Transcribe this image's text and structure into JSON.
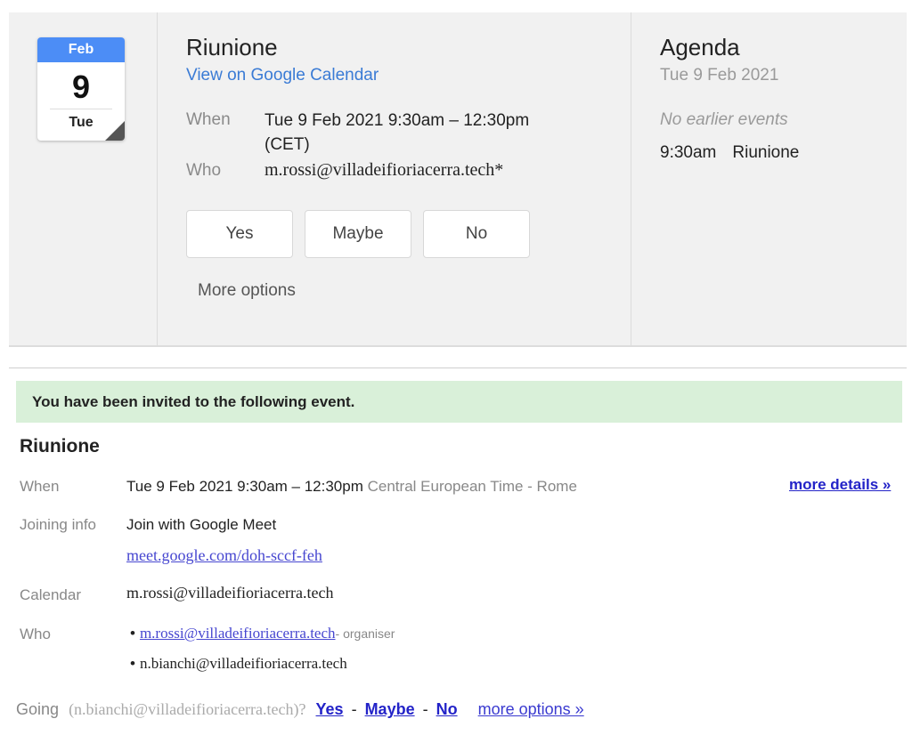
{
  "calendar_tile": {
    "month": "Feb",
    "day": "9",
    "weekday": "Tue"
  },
  "event_card": {
    "title": "Riunione",
    "view_link": "View on Google Calendar",
    "when_label": "When",
    "when_value_line1": "Tue 9 Feb 2021 9:30am – 12:30pm",
    "when_value_line2": "(CET)",
    "who_label": "Who",
    "who_value": "m.rossi@villadeifioriacerra.tech*",
    "rsvp_buttons": [
      "Yes",
      "Maybe",
      "No"
    ],
    "more_options": "More options"
  },
  "agenda": {
    "title": "Agenda",
    "date": "Tue 9 Feb 2021",
    "no_earlier": "No earlier events",
    "event_time": "9:30am",
    "event_name": "Riunione"
  },
  "invitation": {
    "banner": "You have been invited to the following event.",
    "title": "Riunione",
    "when_label": "When",
    "when_value": "Tue 9 Feb 2021 9:30am – 12:30pm",
    "when_tz": "Central European Time - Rome",
    "more_details": "more details »",
    "joining_label": "Joining info",
    "joining_value": "Join with Google Meet",
    "meet_link": "meet.google.com/doh-sccf-feh",
    "calendar_label": "Calendar",
    "calendar_value": "m.rossi@villadeifioriacerra.tech",
    "who_label": "Who",
    "who_list": [
      {
        "email": "m.rossi@villadeifioriacerra.tech",
        "role": "- organiser"
      },
      {
        "email": "n.bianchi@villadeifioriacerra.tech",
        "role": ""
      }
    ],
    "going_label": "Going",
    "going_email": "(n.bianchi@villadeifioriacerra.tech)?",
    "going_yes": "Yes",
    "going_maybe": "Maybe",
    "going_no": "No",
    "going_sep": "-",
    "going_more": "more options »"
  },
  "colors": {
    "accent_blue": "#4c8df6",
    "banner_green": "#d9f0d9",
    "link_blue": "#2323c8"
  }
}
